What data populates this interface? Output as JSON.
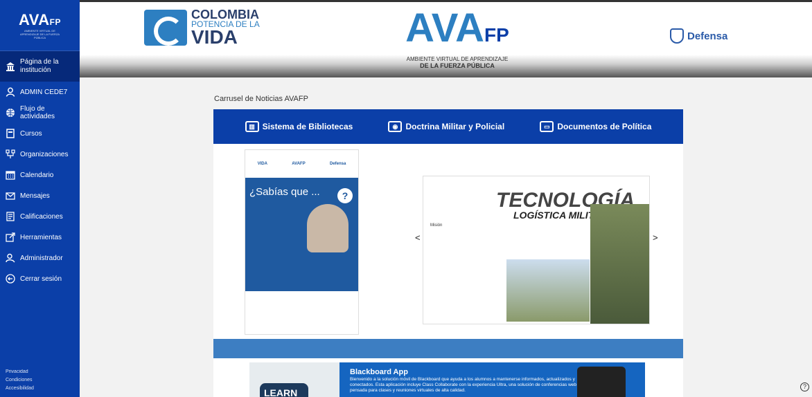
{
  "sidebar": {
    "logo": {
      "name": "AVA",
      "suffix": "FP",
      "subtitle": "AMBIENTE VIRTUAL DE APRENDIZAJE DE LA FUERZA PÚBLICA"
    },
    "items": [
      {
        "label": "Página de la institución",
        "icon": "institution-icon"
      },
      {
        "label": "ADMIN CEDE7",
        "icon": "user-icon"
      },
      {
        "label": "Flujo de actividades",
        "icon": "globe-icon"
      },
      {
        "label": "Cursos",
        "icon": "book-icon"
      },
      {
        "label": "Organizaciones",
        "icon": "org-icon"
      },
      {
        "label": "Calendario",
        "icon": "calendar-icon"
      },
      {
        "label": "Mensajes",
        "icon": "mail-icon"
      },
      {
        "label": "Calificaciones",
        "icon": "grades-icon"
      },
      {
        "label": "Herramientas",
        "icon": "tools-icon"
      },
      {
        "label": "Administrador",
        "icon": "admin-icon"
      },
      {
        "label": "Cerrar sesión",
        "icon": "logout-icon"
      }
    ],
    "footer": [
      "Privacidad",
      "Condiciones",
      "Accesibilidad"
    ]
  },
  "banner": {
    "colombia": {
      "l1": "COLOMBIA",
      "l2": "POTENCIA DE LA",
      "l3": "VIDA"
    },
    "center": {
      "name": "AVA",
      "suffix": "FP",
      "sub1": "AMBIENTE VIRTUAL DE APRENDIZAJE",
      "sub2": "DE LA FUERZA PÚBLICA"
    },
    "defensa": "Defensa"
  },
  "main": {
    "section_title": "Carrusel de Noticias AVAFP",
    "nav": [
      {
        "label": "Sistema de Bibliotecas",
        "icon": "library-icon"
      },
      {
        "label": "Doctrina Militar y Policial",
        "icon": "doctrine-icon"
      },
      {
        "label": "Documentos de Política",
        "icon": "folder-icon"
      }
    ],
    "poster": {
      "title": "¿Sabías que ...",
      "top_left": "VIDA",
      "top_mid": "AVAFP",
      "top_right": "Defensa"
    },
    "slide": {
      "title": "TECNOLOGÍA",
      "subtitle": "LOGÍSTICA MILITAR",
      "mision": "Misión"
    },
    "arrows": {
      "prev": "<",
      "next": ">"
    },
    "blackboard": {
      "title": "Blackboard App",
      "text": "Bienvenido a la solución móvil de Blackboard que ayuda a los alumnos a mantenerse informados, actualizados y conectados. Esta aplicación incluye Class Collaborate con la experiencia Ultra, una solución de conferencias web pensada para clases y reuniones virtuales de alta calidad.",
      "learn": "LEARN"
    }
  },
  "help": "?"
}
